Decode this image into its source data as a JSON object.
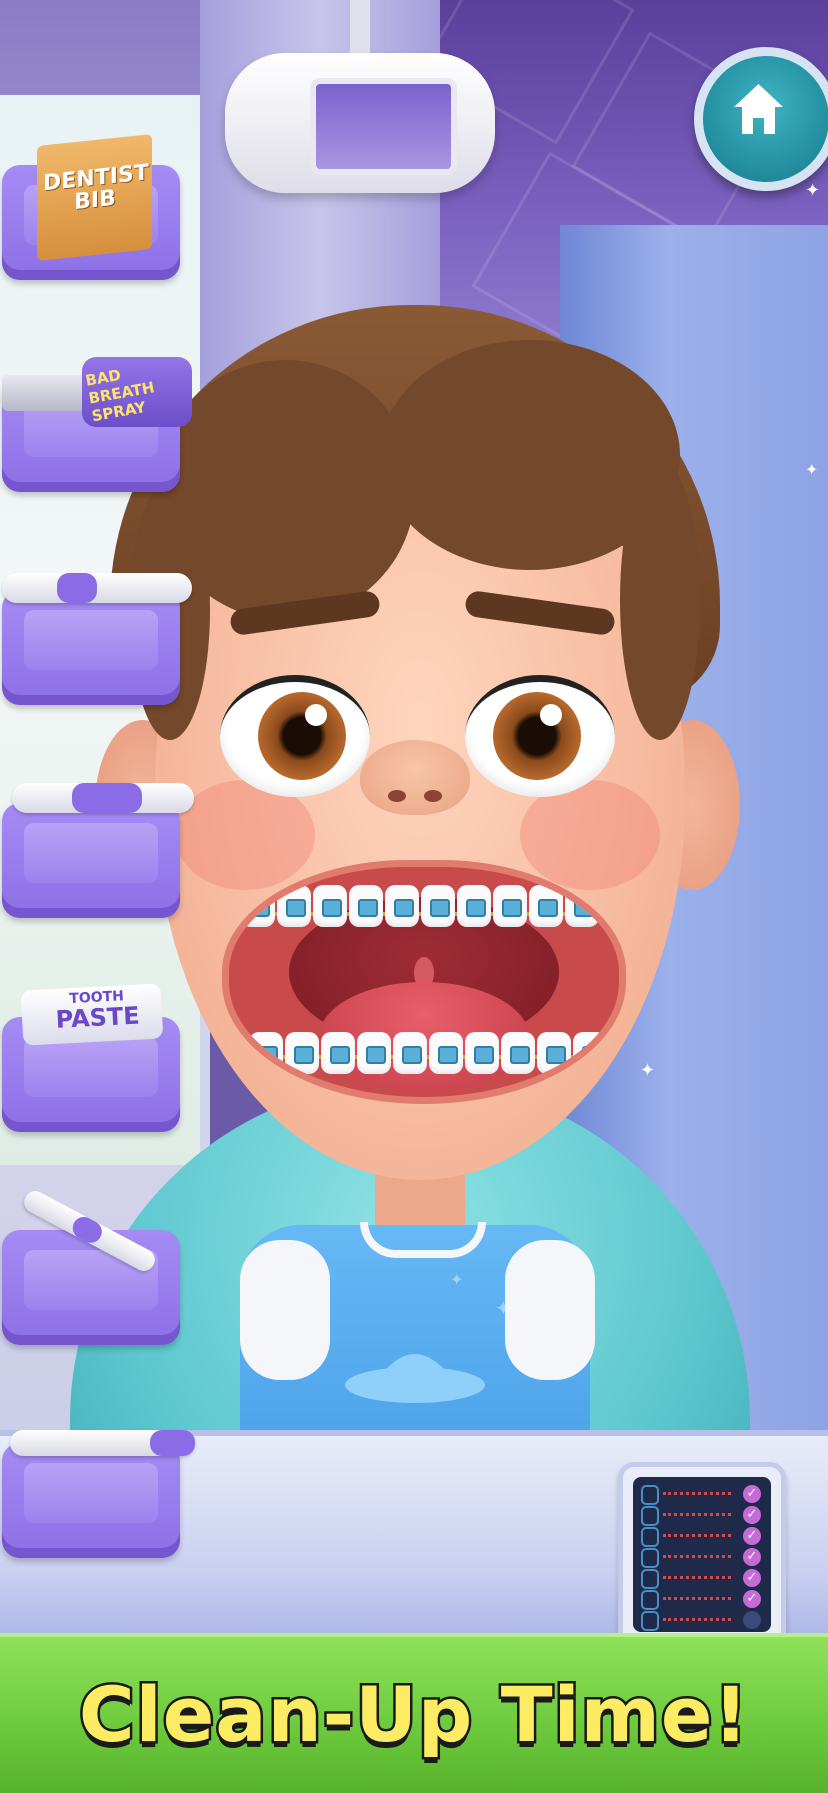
{
  "banner": {
    "text": "Clean-Up Time!"
  },
  "home_button": {
    "icon": "home-icon",
    "color": "#1f8a9c"
  },
  "tools": [
    {
      "name": "dentist-bib",
      "icon": "bib-box-icon",
      "label_lines": [
        "DENTIST",
        "BIB"
      ]
    },
    {
      "name": "bad-breath-spray",
      "icon": "spray-can-icon",
      "label": "BAD BREATH SPRAY"
    },
    {
      "name": "electric-brush-1",
      "icon": "electric-toothbrush-icon"
    },
    {
      "name": "electric-brush-2",
      "icon": "electric-toothbrush-icon"
    },
    {
      "name": "toothpaste",
      "icon": "toothpaste-icon",
      "label_lines": [
        "TOOTH",
        "PASTE"
      ]
    },
    {
      "name": "dental-drill",
      "icon": "dental-drill-icon"
    },
    {
      "name": "water-pick",
      "icon": "water-pick-icon"
    }
  ],
  "checklist": {
    "items_total": 7,
    "items_checked": 6
  },
  "colors": {
    "tray": "#9b7ff0",
    "banner": "#6bc83a",
    "banner_text": "#fbec63"
  }
}
